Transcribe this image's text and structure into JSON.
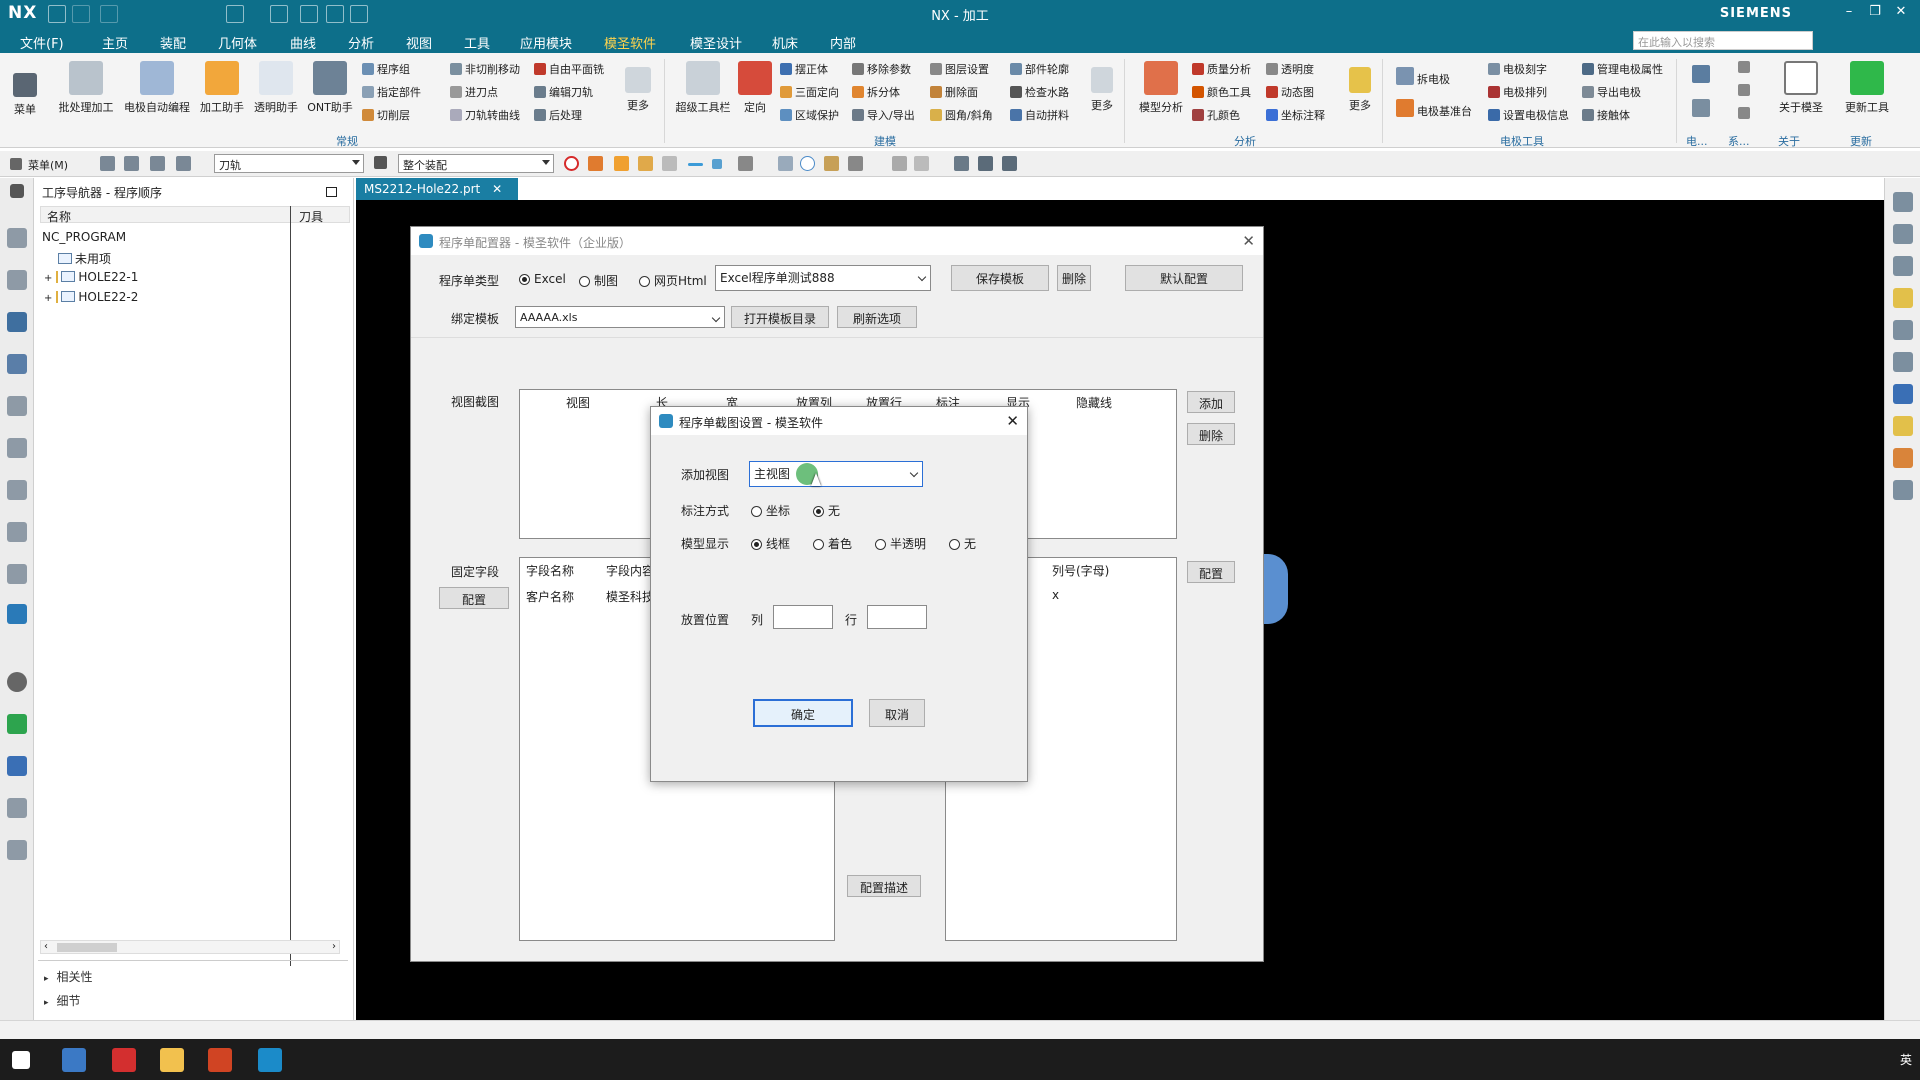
{
  "titlebar": {
    "logo": "NX",
    "title": "NX - 加工",
    "brand": "SIEMENS",
    "min": "–",
    "max": "❐",
    "close": "✕"
  },
  "menu": {
    "tabs": [
      "文件(F)",
      "主页",
      "装配",
      "几何体",
      "曲线",
      "分析",
      "视图",
      "工具",
      "应用模块",
      "模圣软件",
      "模圣设计",
      "机床",
      "内部"
    ],
    "active_index": 9,
    "search_placeholder": "在此输入以搜索"
  },
  "ribbon": {
    "menu_label": "菜单",
    "big_buttons": [
      "批处理加工",
      "电极自动编程",
      "加工助手",
      "透明助手",
      "ONT助手"
    ],
    "small_col1": [
      "程序组",
      "指定部件",
      "切削层"
    ],
    "small_col2": [
      "非切削移动",
      "进刀点",
      "刀轨转曲线"
    ],
    "small_col3": [
      "自由平面铣",
      "编辑刀轨",
      "后处理"
    ],
    "more1": "更多",
    "group1": "常规",
    "big2": [
      "超级工具栏",
      "定向"
    ],
    "small_col4": [
      "摆正体",
      "三面定向",
      "区域保护"
    ],
    "small_col5": [
      "移除参数",
      "拆分体",
      "导入/导出"
    ],
    "small_col6": [
      "图层设置",
      "删除面",
      "圆角/斜角"
    ],
    "small_col7": [
      "部件轮廓",
      "检查水路",
      "自动拼料"
    ],
    "more2": "更多",
    "group2": "建模",
    "big3": "模型分析",
    "small_col8": [
      "质量分析",
      "颜色工具",
      "孔颜色"
    ],
    "small_col9": [
      "透明度",
      "动态图",
      "坐标注释"
    ],
    "more3": "更多",
    "group3": "分析",
    "small_col10": [
      "拆电极",
      "电极基准台"
    ],
    "small_col11": [
      "电极刻字",
      "电极排列",
      "设置电极信息"
    ],
    "small_col12": [
      "管理电极属性",
      "导出电极",
      "接触体"
    ],
    "group4": "电极工具",
    "group5": "电...",
    "group6": "系...",
    "big4": "关于模圣",
    "group7": "关于",
    "big5": "更新工具",
    "group8": "更新"
  },
  "toolbar2": {
    "menu": "菜单(M)",
    "filter": "刀轨",
    "scope": "整个装配"
  },
  "navigator": {
    "title": "工序导航器 - 程序顺序",
    "col_name": "名称",
    "col_tool": "刀具",
    "root": "NC_PROGRAM",
    "items": [
      "未用项",
      "HOLE22-1",
      "HOLE22-2"
    ],
    "sections": [
      "相关性",
      "细节"
    ]
  },
  "file_tab": {
    "label": "MS2212-Hole22.prt",
    "close": "✕"
  },
  "config_dialog": {
    "title": "程序单配置器 - 模圣软件（企业版）",
    "type_label": "程序单类型",
    "type_options": [
      "Excel",
      "制图",
      "网页Html"
    ],
    "type_selected": 0,
    "template_name": "Excel程序单测试888",
    "save_template": "保存模板",
    "delete": "删除",
    "default_config": "默认配置",
    "bind_label": "绑定模板",
    "bind_value": "AAAAA.xls",
    "open_dir": "打开模板目录",
    "refresh": "刷新选项",
    "view_label": "视图截图",
    "view_cols": [
      "视图",
      "长",
      "宽",
      "放置列",
      "放置行",
      "标注",
      "显示",
      "隐藏线"
    ],
    "add": "添加",
    "remove": "删除",
    "fixed_label": "固定字段",
    "config": "配置",
    "fixed_cols": [
      "字段名称",
      "字段内容"
    ],
    "fixed_rows": [
      [
        "客户名称",
        "模圣科技"
      ]
    ],
    "col_header": "列号(字母)",
    "col_value": "x",
    "config2": "配置",
    "config_desc": "配置描述"
  },
  "view_dialog": {
    "title": "程序单截图设置 - 模圣软件",
    "add_view_label": "添加视图",
    "add_view_value": "主视图",
    "mark_label": "标注方式",
    "mark_options": [
      "坐标",
      "无"
    ],
    "mark_selected": 1,
    "display_label": "模型显示",
    "display_options": [
      "线框",
      "着色",
      "半透明",
      "无"
    ],
    "display_selected": 0,
    "place_label": "放置位置",
    "col_label": "列",
    "row_label": "行",
    "col_value": "",
    "row_value": "",
    "ok": "确定",
    "cancel": "取消"
  },
  "taskbar": {
    "tray": "英"
  },
  "colors": {
    "titlebar": "#0d6f8a",
    "active_tab": "#ffd34d",
    "graphics_bg": "#000000",
    "accent": "#2b6fd6"
  }
}
